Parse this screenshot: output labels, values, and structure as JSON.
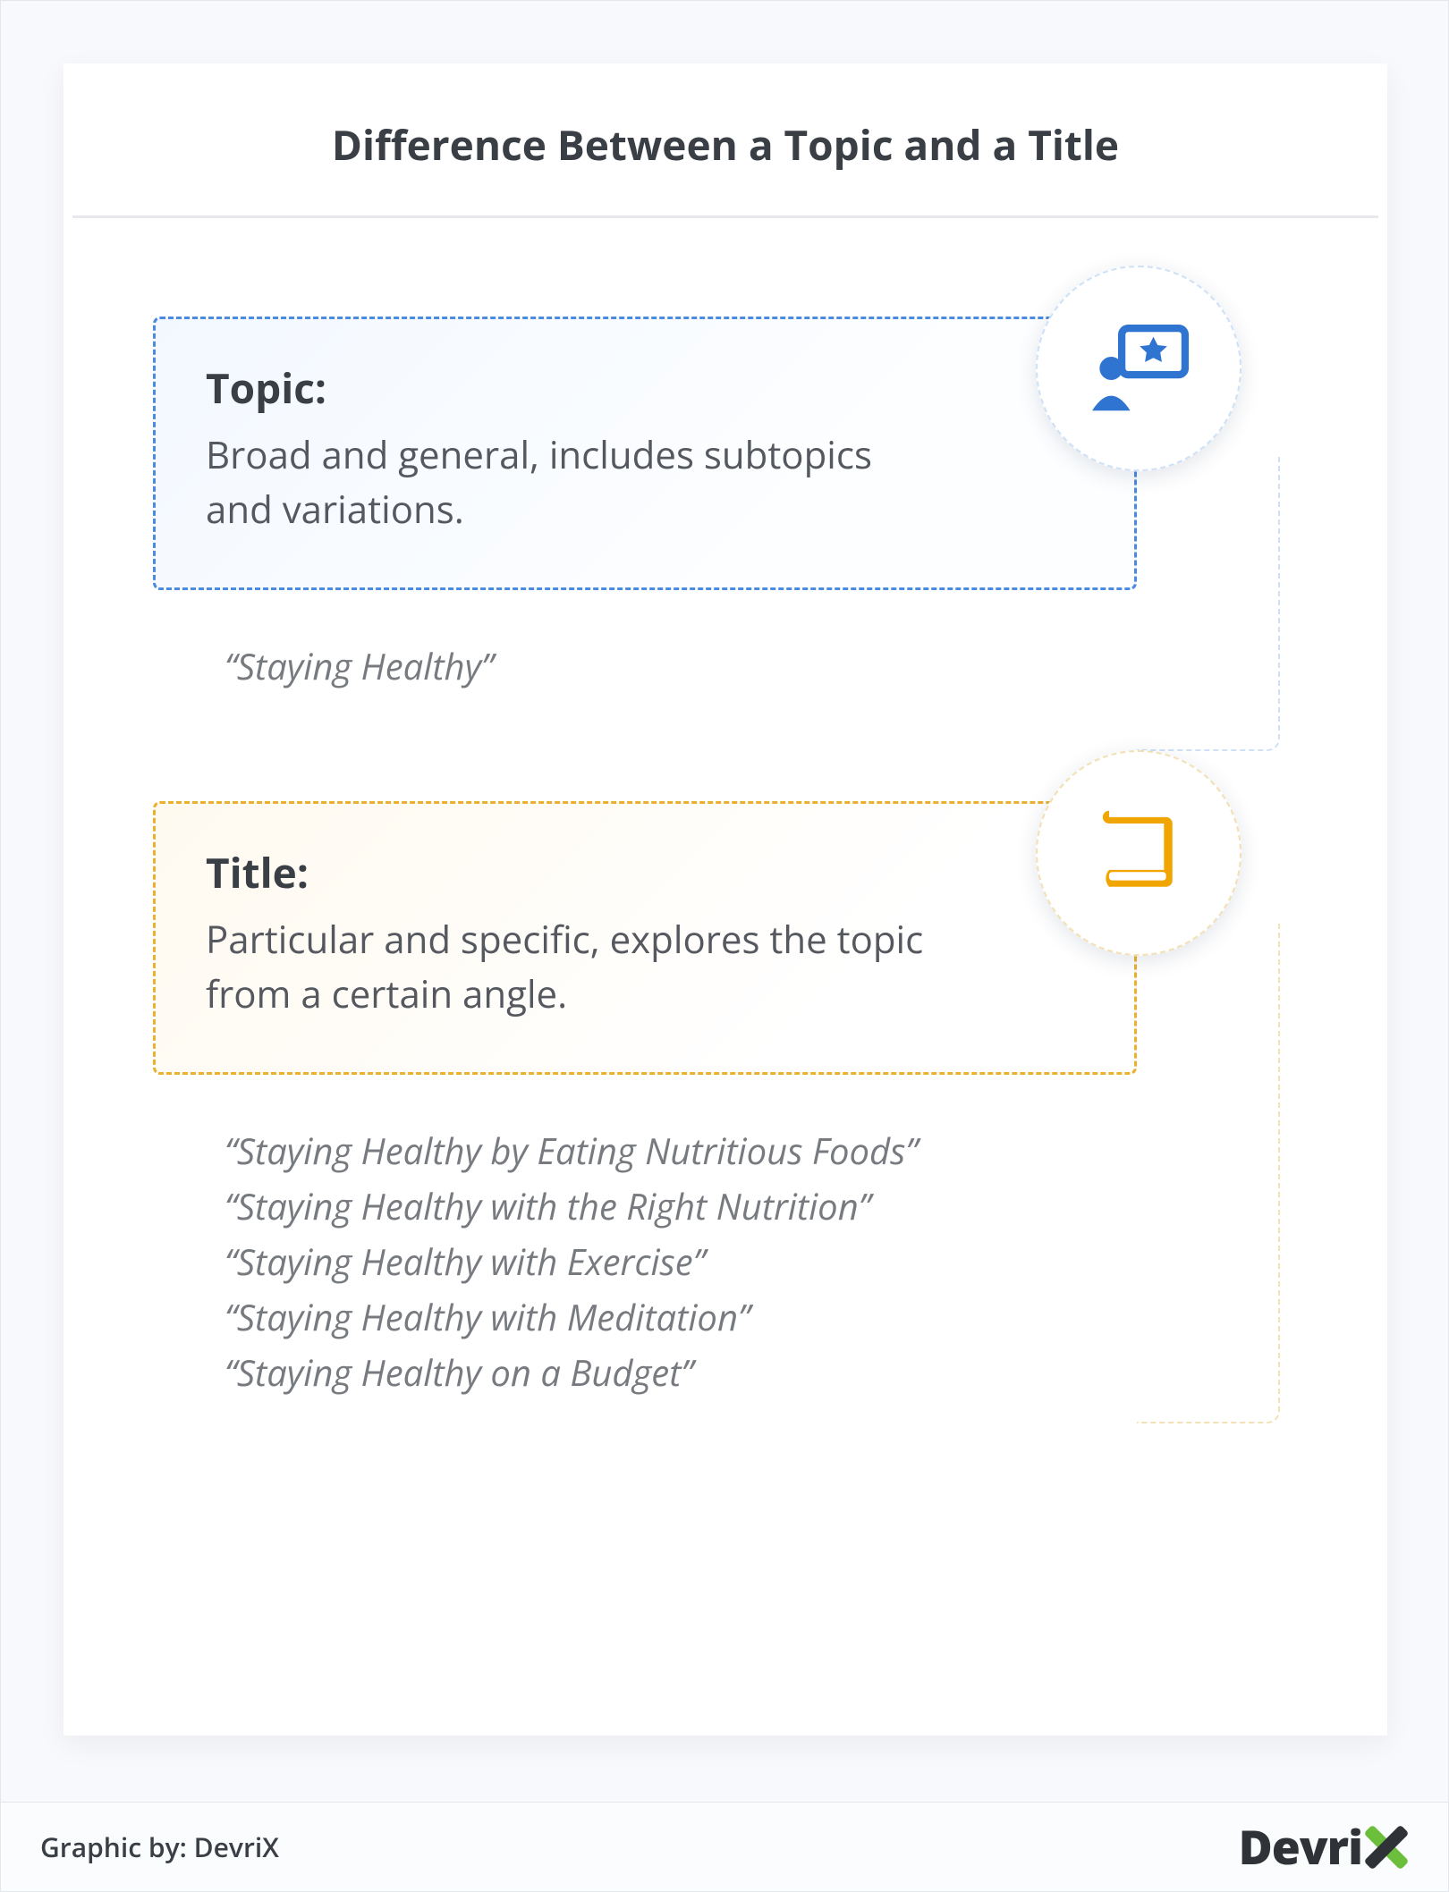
{
  "header": {
    "title": "Difference Between a Topic and a Title"
  },
  "sections": [
    {
      "label": "Topic:",
      "description": "Broad and general, includes subtopics and variations.",
      "color": "blue",
      "icon": "presenter-star-icon",
      "examples": [
        "“Staying Healthy”"
      ]
    },
    {
      "label": "Title:",
      "description": "Particular and specific, explores the topic from a certain angle.",
      "color": "orange",
      "icon": "book-icon",
      "examples": [
        "“Staying Healthy by Eating Nutritious Foods”",
        "“Staying Healthy with the Right Nutrition”",
        "“Staying Healthy with Exercise”",
        "“Staying Healthy with Meditation”",
        "“Staying Healthy on a Budget”"
      ]
    }
  ],
  "footer": {
    "credit": "Graphic by: DevriX",
    "brand": "Devri"
  }
}
